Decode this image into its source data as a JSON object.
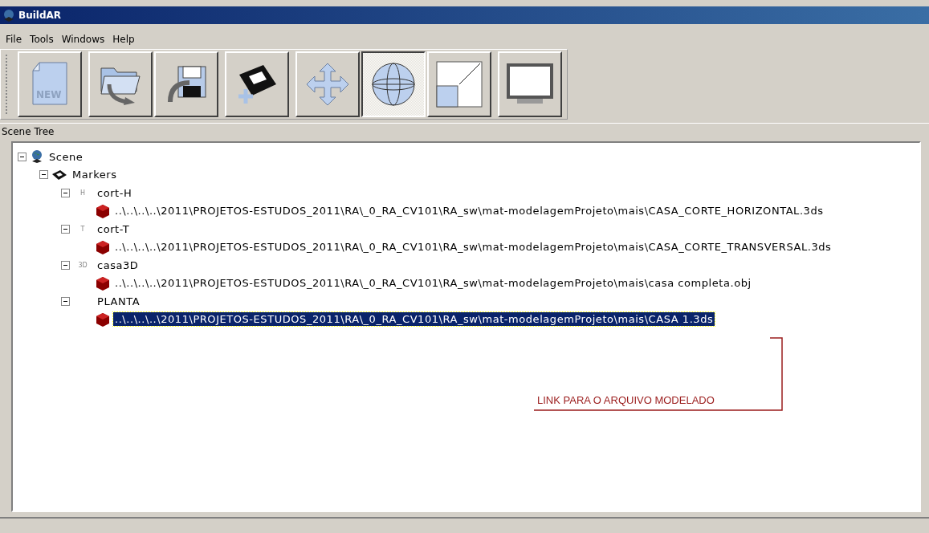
{
  "window": {
    "title": "BuildAR"
  },
  "menu": [
    {
      "label": "File"
    },
    {
      "label": "Tools"
    },
    {
      "label": "Windows"
    },
    {
      "label": "Help"
    }
  ],
  "toolbar": {
    "groups": [
      [
        {
          "kind": "new",
          "label": "NEW",
          "selected": false
        }
      ],
      [
        {
          "kind": "open",
          "selected": false
        },
        {
          "kind": "save",
          "selected": false
        }
      ],
      [
        {
          "kind": "add-marker",
          "selected": false
        }
      ],
      [
        {
          "kind": "move",
          "selected": false
        },
        {
          "kind": "rotate",
          "selected": true
        },
        {
          "kind": "scale",
          "selected": false
        }
      ],
      [
        {
          "kind": "view",
          "selected": false
        }
      ]
    ]
  },
  "panel": {
    "title": "Scene Tree"
  },
  "tree": [
    {
      "kind": "scene",
      "label": "Scene",
      "expanded": true,
      "selected": false,
      "children": [
        {
          "kind": "markers",
          "label": "Markers",
          "expanded": true,
          "selected": false,
          "children": [
            {
              "kind": "marker",
              "badge": "H",
              "label": "cort-H",
              "expanded": true,
              "selected": false,
              "children": [
                {
                  "kind": "model",
                  "label": "..\\..\\..\\..\\2011\\PROJETOS-ESTUDOS_2011\\RA\\_0_RA_CV101\\RA_sw\\mat-modelagemProjeto\\mais\\CASA_CORTE_HORIZONTAL.3ds",
                  "selected": false
                }
              ]
            },
            {
              "kind": "marker",
              "badge": "T",
              "label": "cort-T",
              "expanded": true,
              "selected": false,
              "children": [
                {
                  "kind": "model",
                  "label": "..\\..\\..\\..\\2011\\PROJETOS-ESTUDOS_2011\\RA\\_0_RA_CV101\\RA_sw\\mat-modelagemProjeto\\mais\\CASA_CORTE_TRANSVERSAL.3ds",
                  "selected": false
                }
              ]
            },
            {
              "kind": "marker",
              "badge": "3D",
              "label": "casa3D",
              "expanded": true,
              "selected": false,
              "children": [
                {
                  "kind": "model",
                  "label": "..\\..\\..\\..\\2011\\PROJETOS-ESTUDOS_2011\\RA\\_0_RA_CV101\\RA_sw\\mat-modelagemProjeto\\mais\\casa completa.obj",
                  "selected": false
                }
              ]
            },
            {
              "kind": "marker",
              "label": "PLANTA",
              "expanded": true,
              "selected": false,
              "children": [
                {
                  "kind": "model",
                  "label": "..\\..\\..\\..\\2011\\PROJETOS-ESTUDOS_2011\\RA\\_0_RA_CV101\\RA_sw\\mat-modelagemProjeto\\mais\\CASA 1.3ds",
                  "selected": true
                }
              ]
            }
          ]
        }
      ]
    }
  ],
  "annotation": {
    "text": "LINK PARA O ARQUIVO MODELADO"
  }
}
